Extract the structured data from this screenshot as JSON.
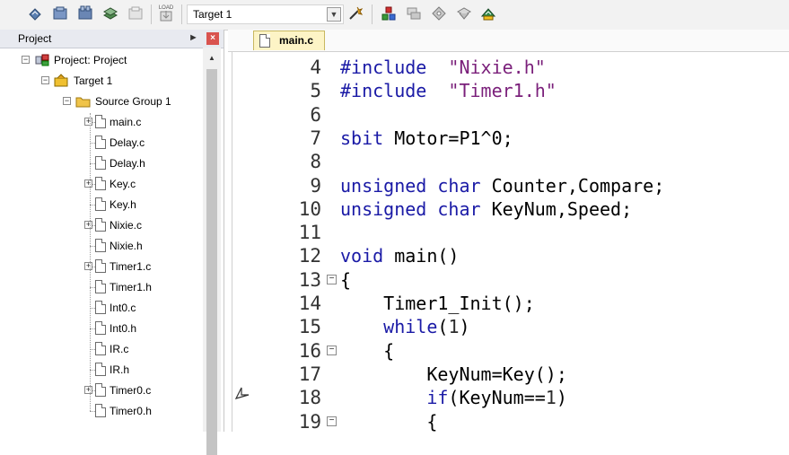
{
  "toolbar": {
    "target": "Target 1",
    "icons": [
      "translate-icon",
      "build-icon",
      "rebuild-icon",
      "batch-build-icon",
      "stop-build-icon",
      "load-icon",
      "target-options-icon",
      "manage-components-icon",
      "pack-installer-icon",
      "select-packs-icon",
      "manage-rte-icon",
      "multiproject-icon"
    ],
    "load_label": "LOAD"
  },
  "project": {
    "title": "Project",
    "tree": [
      {
        "label": "Project: Project",
        "depth": 0,
        "kind": "project",
        "expand": "−"
      },
      {
        "label": "Target 1",
        "depth": 1,
        "kind": "target",
        "expand": "−"
      },
      {
        "label": "Source Group 1",
        "depth": 2,
        "kind": "folder",
        "expand": "−"
      },
      {
        "label": "main.c",
        "depth": 3,
        "kind": "file",
        "expand": "+"
      },
      {
        "label": "Delay.c",
        "depth": 3,
        "kind": "file",
        "expand": ""
      },
      {
        "label": "Delay.h",
        "depth": 3,
        "kind": "file",
        "expand": ""
      },
      {
        "label": "Key.c",
        "depth": 3,
        "kind": "file",
        "expand": "+"
      },
      {
        "label": "Key.h",
        "depth": 3,
        "kind": "file",
        "expand": ""
      },
      {
        "label": "Nixie.c",
        "depth": 3,
        "kind": "file",
        "expand": "+"
      },
      {
        "label": "Nixie.h",
        "depth": 3,
        "kind": "file",
        "expand": ""
      },
      {
        "label": "Timer1.c",
        "depth": 3,
        "kind": "file",
        "expand": "+"
      },
      {
        "label": "Timer1.h",
        "depth": 3,
        "kind": "file",
        "expand": ""
      },
      {
        "label": "Int0.c",
        "depth": 3,
        "kind": "file",
        "expand": ""
      },
      {
        "label": "Int0.h",
        "depth": 3,
        "kind": "file",
        "expand": ""
      },
      {
        "label": "IR.c",
        "depth": 3,
        "kind": "file",
        "expand": ""
      },
      {
        "label": "IR.h",
        "depth": 3,
        "kind": "file",
        "expand": ""
      },
      {
        "label": "Timer0.c",
        "depth": 3,
        "kind": "file",
        "expand": "+"
      },
      {
        "label": "Timer0.h",
        "depth": 3,
        "kind": "file",
        "expand": ""
      }
    ]
  },
  "editor": {
    "tab": "main.c",
    "lines": [
      {
        "n": "4",
        "fold": "",
        "code": [
          [
            "kw",
            "#include"
          ],
          [
            "",
            "  "
          ],
          [
            "str",
            "\"Nixie.h\""
          ]
        ]
      },
      {
        "n": "5",
        "fold": "",
        "code": [
          [
            "kw",
            "#include"
          ],
          [
            "",
            "  "
          ],
          [
            "str",
            "\"Timer1.h\""
          ]
        ]
      },
      {
        "n": "6",
        "fold": "",
        "code": []
      },
      {
        "n": "7",
        "fold": "",
        "code": [
          [
            "kw",
            "sbit"
          ],
          [
            "",
            " Motor=P1^0;"
          ]
        ]
      },
      {
        "n": "8",
        "fold": "",
        "code": []
      },
      {
        "n": "9",
        "fold": "",
        "code": [
          [
            "kw",
            "unsigned"
          ],
          [
            "",
            " "
          ],
          [
            "kw",
            "char"
          ],
          [
            "",
            " Counter,Compare;"
          ]
        ]
      },
      {
        "n": "10",
        "fold": "",
        "code": [
          [
            "kw",
            "unsigned"
          ],
          [
            "",
            " "
          ],
          [
            "kw",
            "char"
          ],
          [
            "",
            " KeyNum,Speed;"
          ]
        ]
      },
      {
        "n": "11",
        "fold": "",
        "code": []
      },
      {
        "n": "12",
        "fold": "",
        "code": [
          [
            "kw",
            "void"
          ],
          [
            "",
            " main()"
          ]
        ]
      },
      {
        "n": "13",
        "fold": "−",
        "code": [
          [
            "",
            "{"
          ]
        ]
      },
      {
        "n": "14",
        "fold": "",
        "code": [
          [
            "",
            "    Timer1_Init();"
          ]
        ]
      },
      {
        "n": "15",
        "fold": "",
        "code": [
          [
            "",
            "    "
          ],
          [
            "kw",
            "while"
          ],
          [
            "",
            "("
          ],
          [
            "num",
            "1"
          ],
          [
            "",
            ")"
          ]
        ]
      },
      {
        "n": "16",
        "fold": "−",
        "code": [
          [
            "",
            "    {"
          ]
        ]
      },
      {
        "n": "17",
        "fold": "",
        "code": [
          [
            "",
            "        KeyNum=Key();"
          ]
        ]
      },
      {
        "n": "18",
        "fold": "",
        "code": [
          [
            "",
            "        "
          ],
          [
            "kw",
            "if"
          ],
          [
            "",
            "(KeyNum=="
          ],
          [
            "num",
            "1"
          ],
          [
            "",
            ")"
          ]
        ]
      },
      {
        "n": "19",
        "fold": "−",
        "code": [
          [
            "",
            "        {"
          ]
        ]
      }
    ]
  }
}
